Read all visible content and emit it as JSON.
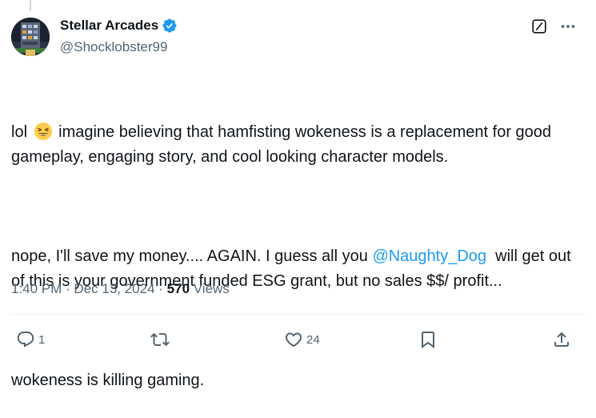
{
  "author": {
    "display_name": "Stellar Arcades",
    "handle": "@Shocklobster99",
    "verified": true,
    "avatar": "avatar-building-icon"
  },
  "tweet": {
    "paragraph1_start": "lol",
    "paragraph1_emoji": "grinning-squinting-face-emoji",
    "paragraph1_rest": "imagine believing that hamfisting wokeness is a replacement for good gameplay, engaging story, and cool looking character models.",
    "paragraph2_before": "nope, I'll save my money.... AGAIN. I guess all you ",
    "paragraph2_mention": "@Naughty_Dog",
    "paragraph2_after": "  will get out of this is your government funded ESG grant, but no sales $$/ profit...",
    "paragraph3": "wokeness is killing gaming."
  },
  "meta": {
    "time": "1:40 PM",
    "separator": " · ",
    "date": "Dec 13, 2024",
    "separator2": " · ",
    "views_count": "570",
    "views_label": " Views"
  },
  "actions": {
    "replies": "1",
    "reposts": "",
    "likes": "24",
    "bookmarks": "",
    "share": ""
  },
  "colors": {
    "link": "#1d9bf0",
    "secondary_text": "#536471",
    "primary_text": "#0f1419",
    "verified_badge": "#1d9bf0"
  }
}
